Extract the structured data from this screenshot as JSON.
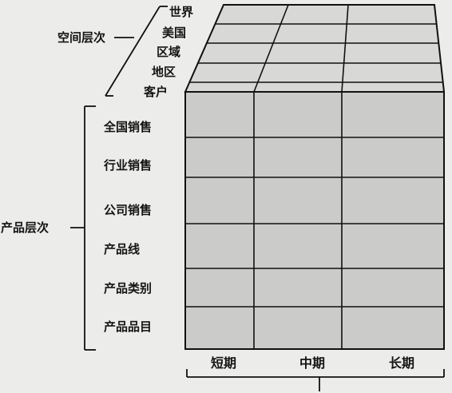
{
  "spatial_dimension": {
    "title": "空间层次",
    "levels": [
      "世界",
      "美国",
      "区域",
      "地区",
      "客户"
    ]
  },
  "product_dimension": {
    "title": "产品层次",
    "levels": [
      "全国销售",
      "行业销售",
      "公司销售",
      "产品线",
      "产品类别",
      "产品品目"
    ]
  },
  "time_dimension": {
    "levels": [
      "短期",
      "中期",
      "长期"
    ]
  },
  "colors": {
    "front": "#cbcbc9",
    "top": "#d8d8d6",
    "line": "#111111"
  }
}
